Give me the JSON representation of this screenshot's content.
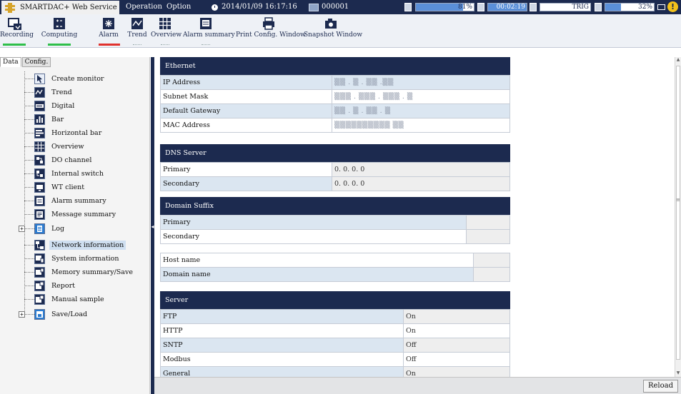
{
  "topbar": {
    "app_title": "SMARTDAC+ Web Service",
    "menu_operation": "Operation",
    "menu_option": "Option",
    "datetime": "2014/01/09 16:17:16",
    "serial": "000001",
    "memory_percent": "81%",
    "memory_fill": 0.81,
    "elapsed": "00:02:19",
    "trigger": "TRIG",
    "storage_percent": "32%",
    "storage_fill": 0.32,
    "warning_glyph": "!"
  },
  "toolbar": {
    "buttons": [
      {
        "label": "Recording",
        "icon": "recording-icon",
        "indicator": "#2fbf4a"
      },
      {
        "label": "Computing",
        "icon": "computing-icon",
        "indicator": "#2fbf4a"
      },
      {
        "label": "Alarm",
        "icon": "alarm-icon",
        "indicator": "#e0312d"
      },
      {
        "label": "Trend",
        "icon": "trend-icon"
      },
      {
        "label": "Overview",
        "icon": "overview-icon"
      },
      {
        "label": "Alarm summary",
        "icon": "alarm-summary-icon"
      },
      {
        "label": "Print Config. Window",
        "icon": "printer-icon"
      },
      {
        "label": "Snapshot Window",
        "icon": "camera-icon"
      }
    ]
  },
  "sidebar": {
    "tabs": [
      "Data",
      "Config."
    ],
    "items": [
      {
        "label": "Create monitor",
        "icon": "create-monitor-icon"
      },
      {
        "label": "Trend",
        "icon": "trend-icon"
      },
      {
        "label": "Digital",
        "icon": "digital-icon"
      },
      {
        "label": "Bar",
        "icon": "bar-icon"
      },
      {
        "label": "Horizontal bar",
        "icon": "horizontal-bar-icon"
      },
      {
        "label": "Overview",
        "icon": "overview-icon"
      },
      {
        "label": "DO channel",
        "icon": "do-channel-icon"
      },
      {
        "label": "Internal switch",
        "icon": "internal-switch-icon"
      },
      {
        "label": "WT client",
        "icon": "wt-client-icon"
      },
      {
        "label": "Alarm summary",
        "icon": "alarm-summary-icon"
      },
      {
        "label": "Message summary",
        "icon": "message-summary-icon"
      },
      {
        "label": "Log",
        "icon": "log-icon"
      },
      {
        "label": "Network information",
        "icon": "network-information-icon"
      },
      {
        "label": "System information",
        "icon": "system-information-icon"
      },
      {
        "label": "Memory summary/Save",
        "icon": "memory-summary-icon"
      },
      {
        "label": "Report",
        "icon": "report-icon"
      },
      {
        "label": "Manual sample",
        "icon": "manual-sample-icon"
      },
      {
        "label": "Save/Load",
        "icon": "save-load-icon"
      }
    ],
    "selected": "Network information",
    "expand_glyph": "+"
  },
  "main": {
    "ethernet": {
      "title": "Ethernet",
      "rows": [
        {
          "label": "IP Address",
          "value": "▒▒ . ▒ . ▒▒ .▒▒"
        },
        {
          "label": "Subnet Mask",
          "value": "▒▒▒ . ▒▒▒ . ▒▒▒ . ▒"
        },
        {
          "label": "Default Gateway",
          "value": "▒▒ . ▒ . ▒▒ . ▒"
        },
        {
          "label": "MAC Address",
          "value": "▒▒▒▒▒▒▒▒▒▒ ▒▒"
        }
      ]
    },
    "dns": {
      "title": "DNS Server",
      "rows": [
        {
          "label": "Primary",
          "value": "0. 0. 0. 0"
        },
        {
          "label": "Secondary",
          "value": "0. 0. 0. 0"
        }
      ]
    },
    "domain_suffix": {
      "title": "Domain Suffix",
      "rows": [
        {
          "label": "Primary",
          "value": ""
        },
        {
          "label": "Secondary",
          "value": ""
        }
      ]
    },
    "names": {
      "rows": [
        {
          "label": "Host name",
          "value": ""
        },
        {
          "label": "Domain name",
          "value": ""
        }
      ]
    },
    "server": {
      "title": "Server",
      "rows": [
        {
          "label": "FTP",
          "value": "On"
        },
        {
          "label": "HTTP",
          "value": "On"
        },
        {
          "label": "SNTP",
          "value": "Off"
        },
        {
          "label": "Modbus",
          "value": "Off"
        },
        {
          "label": "General",
          "value": "On"
        }
      ]
    }
  },
  "footer": {
    "reload_label": "Reload"
  },
  "colors": {
    "navy": "#1c2a4f",
    "row_alt": "#dbe6f1",
    "accent_gold": "#d6a42a"
  }
}
